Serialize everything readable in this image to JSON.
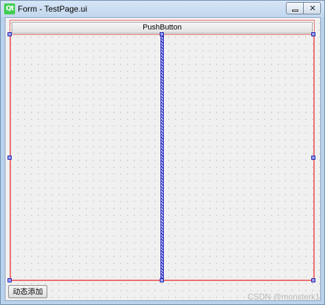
{
  "window": {
    "title": "Form - TestPage.ui",
    "logo_text": "Qt",
    "minimize_icon": "minimize-icon",
    "close_icon": "close-icon",
    "close_glyph": "✕"
  },
  "form": {
    "push_button_label": "PushButton",
    "add_button_label": "动态添加"
  },
  "watermark": {
    "text": "CSDN @monsterk1"
  },
  "colors": {
    "layout_border": "#ee6b6b",
    "splitter_handle": "#3b3bd4",
    "selection_handle": "#9aa4ff",
    "titlebar": "#c2d7ee"
  }
}
